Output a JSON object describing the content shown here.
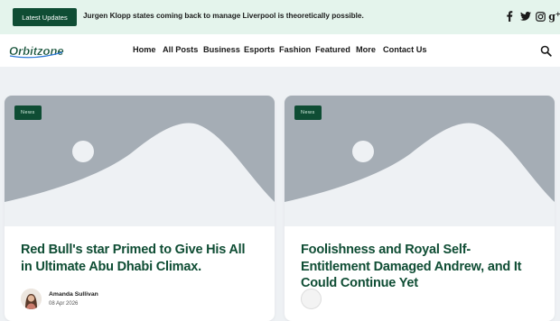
{
  "topbar": {
    "latest_label": "Latest Updates",
    "ticker_text": "Jurgen Klopp states coming back to manage Liverpool is theoretically possible.",
    "social_icons": [
      "facebook-icon",
      "twitter-icon",
      "instagram-icon",
      "google-plus-icon"
    ]
  },
  "header": {
    "logo_text": "Orbitzone",
    "nav": [
      "Home",
      "All Posts",
      "Business",
      "Esports",
      "Fashion",
      "Featured",
      "More",
      "Contact Us"
    ],
    "search_icon": "search-icon"
  },
  "posts": [
    {
      "badge": "News",
      "title": "Red Bull's star Primed to Give His All in Ultimate Abu Dhabi Climax.",
      "author": "Amanda Sullivan",
      "date": "08 Apr 2026"
    },
    {
      "badge": "News",
      "title": "Foolishness and Royal Self-Entitlement Damaged Andrew, and It Could Continue Yet"
    }
  ],
  "colors": {
    "brand_green": "#0f4d34",
    "topbar_bg": "#e4f4ec",
    "page_bg": "#eef1f4",
    "placeholder_fill": "#a5adb5"
  }
}
